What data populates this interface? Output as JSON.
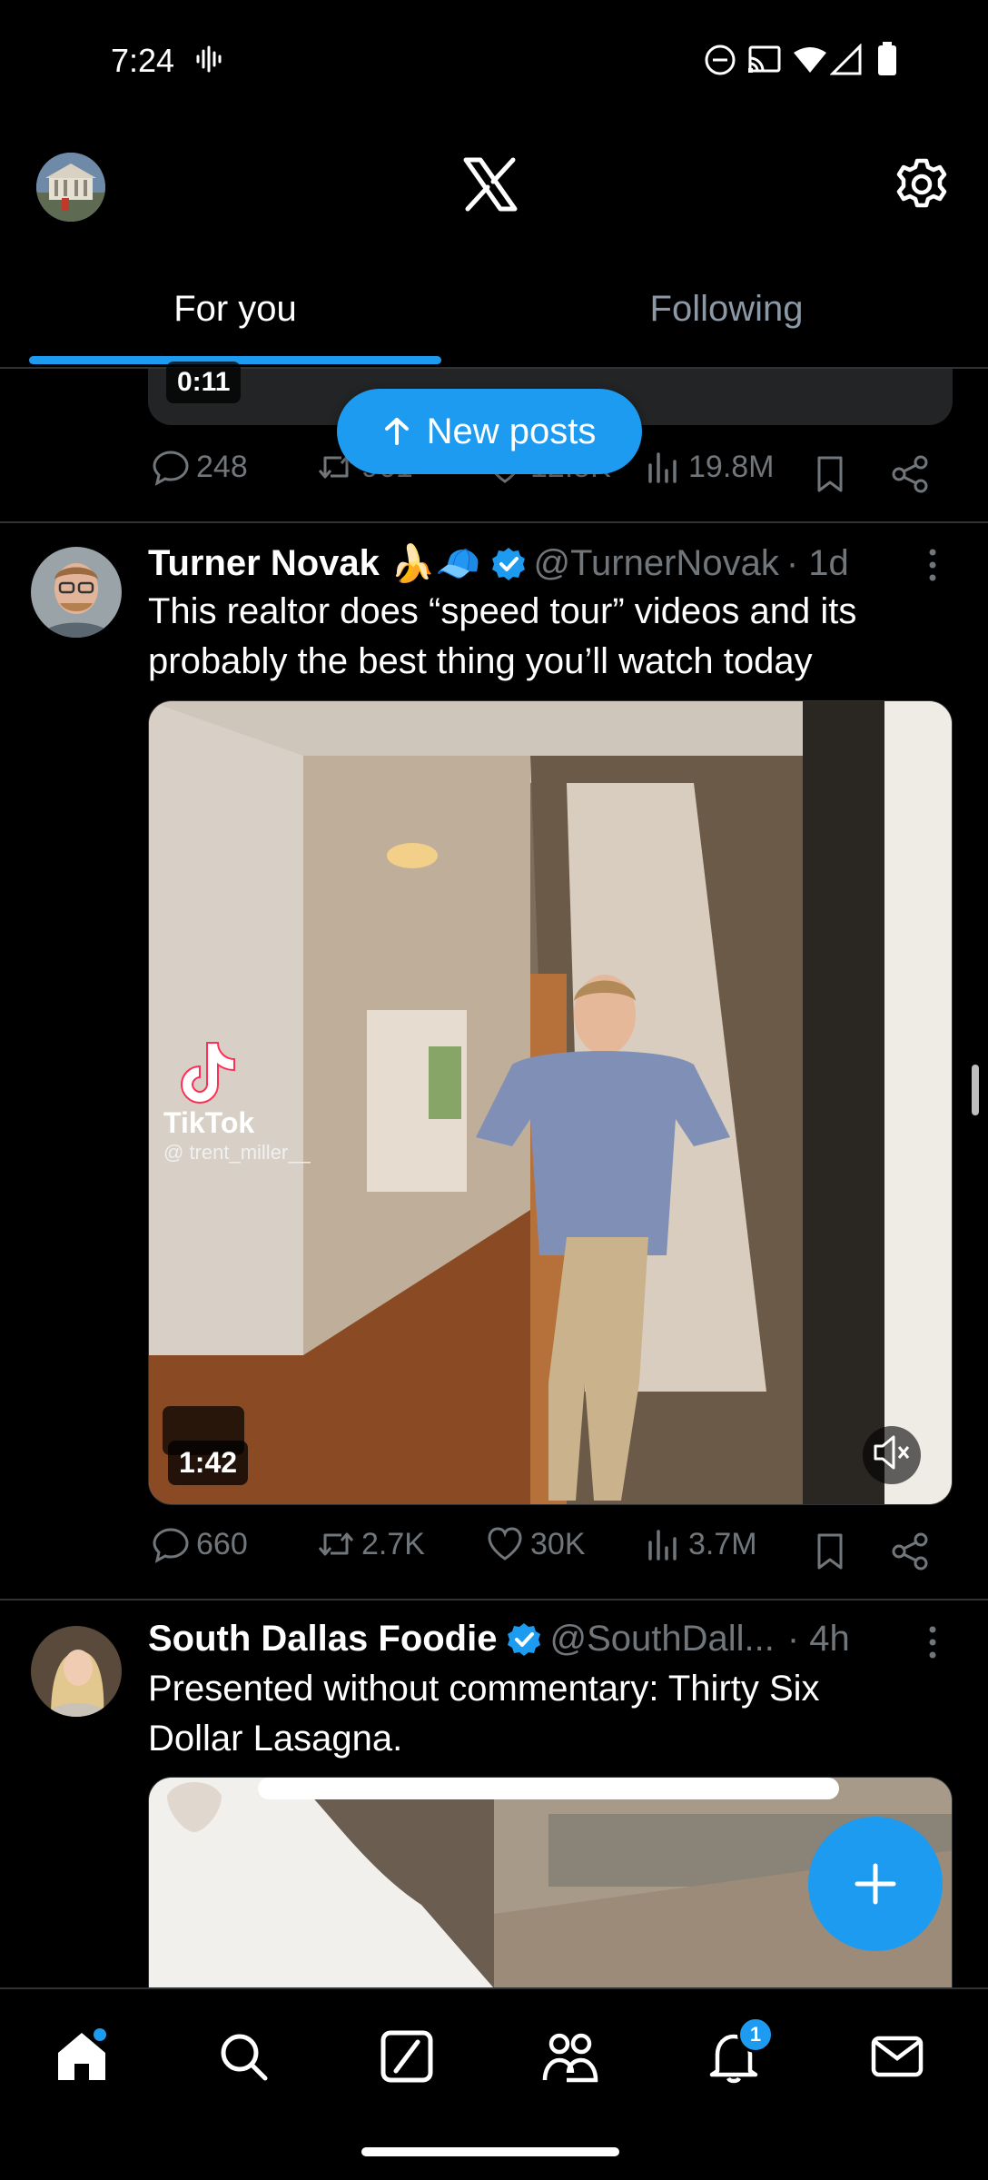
{
  "status_bar": {
    "time": "7:24"
  },
  "tabs": [
    {
      "label": "For you"
    },
    {
      "label": "Following"
    }
  ],
  "new_posts_pill": {
    "label": "New posts"
  },
  "previous_post": {
    "video_duration": "0:11",
    "replies": "248",
    "reposts": "961",
    "likes": "12.5K",
    "views": "19.8M"
  },
  "posts": [
    {
      "display_name": "Turner Novak",
      "emojis": "🍌🧢",
      "verified": true,
      "handle": "@TurnerNovak",
      "time": "· 1d",
      "text_line1": "This realtor does “speed tour” videos and its",
      "text_line2": "probably the best thing you’ll watch today",
      "video": {
        "duration": "1:42",
        "watermark": "TikTok",
        "watermark_user": "@ trent_miller__",
        "muted": true
      },
      "replies": "660",
      "reposts": "2.7K",
      "likes": "30K",
      "views": "3.7M"
    },
    {
      "display_name": "South Dallas Foodie",
      "verified": true,
      "handle": "@SouthDall...",
      "time": "· 4h",
      "text_line1": "Presented without commentary: Thirty Six",
      "text_line2": "Dollar Lasagna."
    }
  ],
  "bottom_nav": {
    "items": [
      "home",
      "search",
      "grok",
      "communities",
      "notifications",
      "messages"
    ],
    "notifications_badge": "1"
  },
  "colors": {
    "accent": "#1d9bf0",
    "background": "#000000",
    "muted_text": "#71767b"
  }
}
